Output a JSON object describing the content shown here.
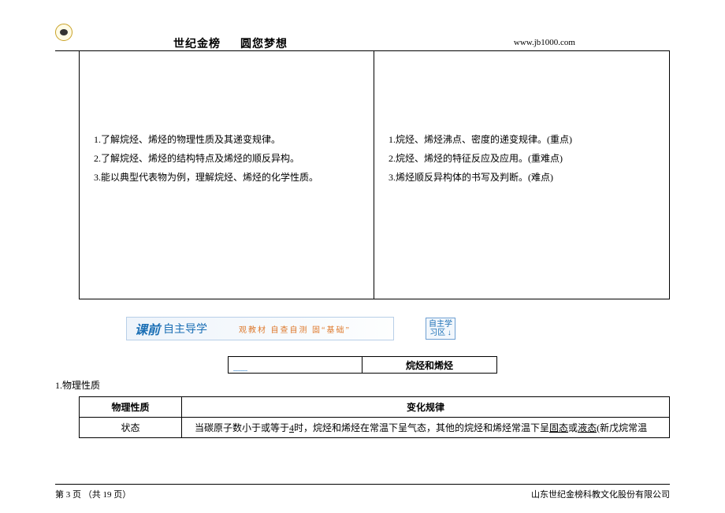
{
  "header": {
    "title": "世纪金榜",
    "subtitle": "圆您梦想",
    "url": "www.jb1000.com"
  },
  "goals": {
    "left": [
      "1.了解烷烃、烯烃的物理性质及其递变规律。",
      "2.了解烷烃、烯烃的结构特点及烯烃的顺反异构。",
      "3.能以典型代表物为例，理解烷烃、烯烃的化学性质。"
    ],
    "right": [
      "1.烷烃、烯烃沸点、密度的递变规律。(重点)",
      "2.烷烃、烯烃的特征反应及应用。(重难点)",
      "3.烯烃顺反异构体的书写及判断。(难点)"
    ]
  },
  "banner": {
    "kq": "课前",
    "zz": "自主导学",
    "sub": "观教材 自查自测 固“基础”",
    "badge_line1": "自主学",
    "badge_line2": "习区 ↓"
  },
  "topic": {
    "label": "烷烃和烯烃"
  },
  "section": {
    "num": "1.物理性质",
    "th1": "物理性质",
    "th2": "变化规律",
    "row1_label": "状态",
    "row1_prefix": "当碳原子数小于或等于",
    "row1_four": "4",
    "row1_mid": "时，烷烃和烯烃在常温下呈气态，其他的烷烃和烯烃常温下呈",
    "row1_solid": "固态",
    "row1_or": "或",
    "row1_liquid": "液态",
    "row1_suffix": "(新戊烷常温"
  },
  "footer": {
    "page": "第 3 页 （共 19 页）",
    "company": "山东世纪金榜科教文化股份有限公司"
  }
}
